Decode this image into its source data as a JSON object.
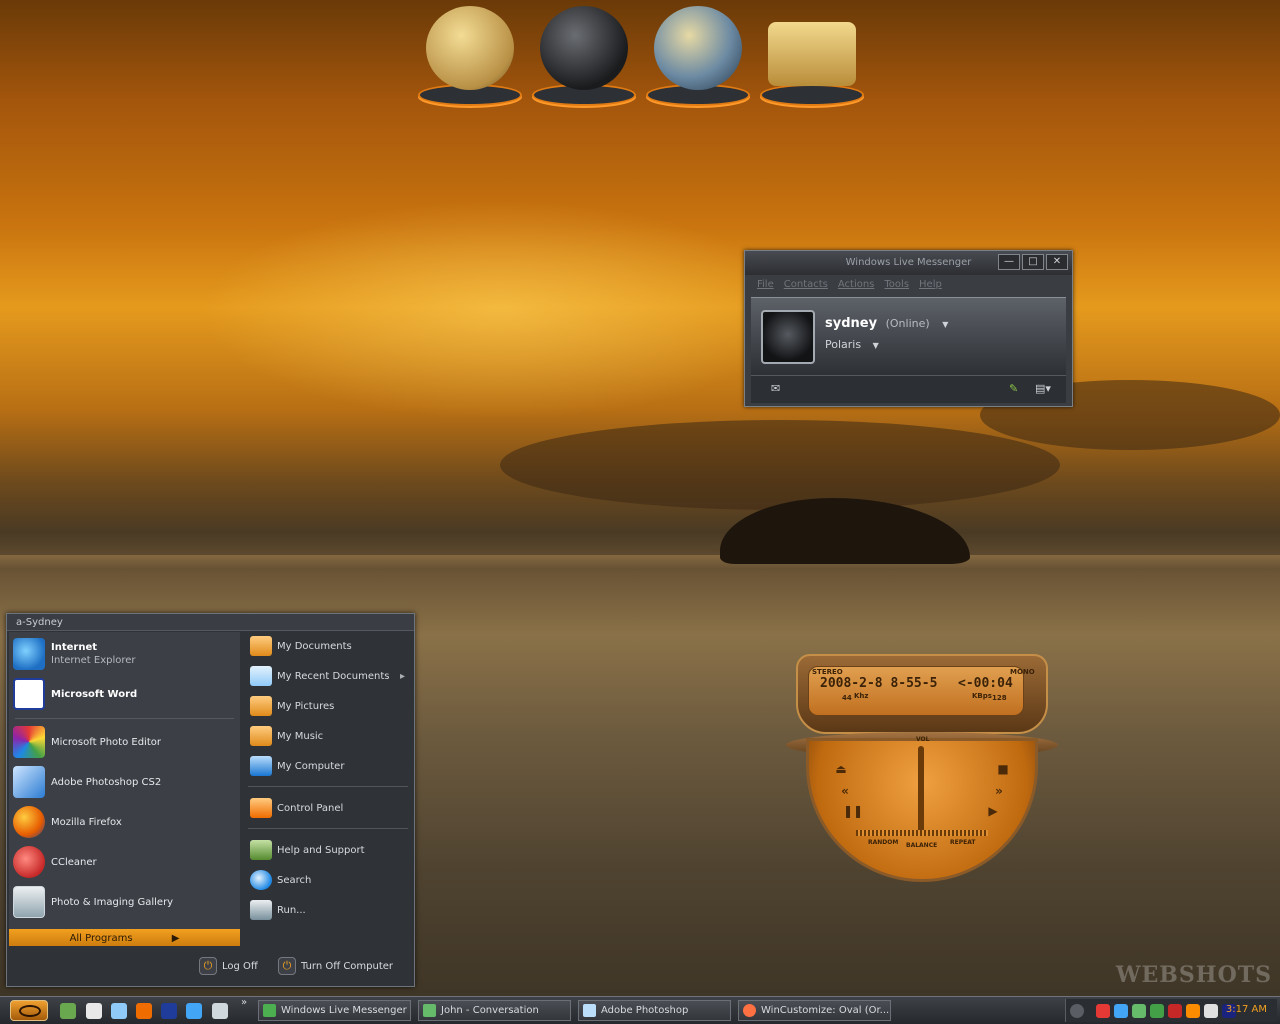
{
  "desktop": {
    "watermark": "WEBSHOTS"
  },
  "dock": {
    "items": [
      {
        "name": "disk-icon"
      },
      {
        "name": "firefox-icon"
      },
      {
        "name": "globe-icon"
      },
      {
        "name": "folder-icon"
      }
    ]
  },
  "messenger": {
    "title": "Windows Live Messenger",
    "menu": [
      "File",
      "Contacts",
      "Actions",
      "Tools",
      "Help"
    ],
    "user_name": "sydney",
    "user_status": "(Online)",
    "personal_message": "Polaris",
    "controls": {
      "minimize": "—",
      "maximize": "□",
      "close": "✕"
    }
  },
  "player": {
    "date_display": "2008-2-8 8-55-5",
    "remaining": "<-00:04",
    "stereo": "STEREO",
    "mono": "MONO",
    "khz": "44",
    "khz_unit": "Khz",
    "kbps": "128",
    "kbps_unit": "KBps",
    "vol": "VOL",
    "random": "RANDOM",
    "balance": "BALANCE",
    "repeat": "REPEAT"
  },
  "start_menu": {
    "user": "a-Sydney",
    "pinned": [
      {
        "title": "Internet",
        "subtitle": "Internet Explorer"
      },
      {
        "title": "Microsoft Word",
        "subtitle": ""
      }
    ],
    "recent": [
      "Microsoft Photo Editor",
      "Adobe Photoshop CS2",
      "Mozilla Firefox",
      "CCleaner",
      "Photo & Imaging Gallery"
    ],
    "all_programs": "All Programs",
    "right": [
      "My Documents",
      "My Recent Documents",
      "My Pictures",
      "My Music",
      "My Computer",
      "Control Panel",
      "Help and Support",
      "Search",
      "Run..."
    ],
    "log_off": "Log Off",
    "turn_off": "Turn Off Computer"
  },
  "taskbar": {
    "tasks": [
      "Windows Live Messenger",
      "John - Conversation",
      "Adobe Photoshop",
      "WinCustomize: Oval (Or..."
    ],
    "overflow": "»",
    "clock": "3:17 AM"
  },
  "colors": {
    "accent": "#f0a020",
    "panel": "#2f3338"
  }
}
